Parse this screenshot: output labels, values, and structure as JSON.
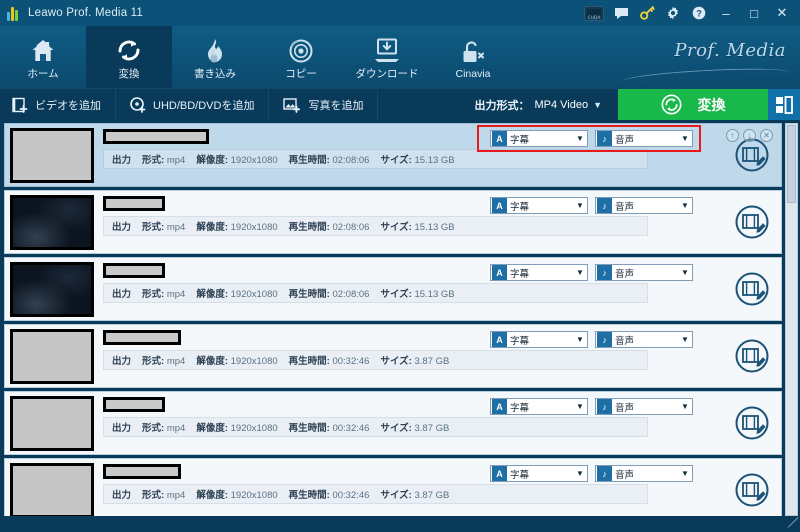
{
  "window": {
    "title": "Leawo Prof. Media 11",
    "logo_icon": "leawo-logo",
    "titlebar_icons": [
      {
        "name": "cuda-badge-icon",
        "label": "CUDA"
      },
      {
        "name": "feedback-icon",
        "label": "■"
      },
      {
        "name": "key-icon",
        "label": "⚷"
      },
      {
        "name": "gear-icon",
        "label": "⚙"
      },
      {
        "name": "help-icon",
        "label": "?"
      }
    ],
    "controls": {
      "minimize": "–",
      "maximize": "□",
      "close": "✕"
    }
  },
  "brand": {
    "text": "Prof. Media"
  },
  "nav": {
    "tabs": [
      {
        "label": "ホーム",
        "icon": "home-icon",
        "active": false
      },
      {
        "label": "変換",
        "icon": "convert-icon",
        "active": true
      },
      {
        "label": "書き込み",
        "icon": "burn-icon",
        "active": false
      },
      {
        "label": "コピー",
        "icon": "copy-disc-icon",
        "active": false
      },
      {
        "label": "ダウンロード",
        "icon": "download-icon",
        "active": false
      },
      {
        "label": "Cinavia",
        "icon": "cinavia-lock-icon",
        "active": false
      }
    ]
  },
  "toolbar": {
    "add_video": "ビデオを追加",
    "add_disc": "UHD/BD/DVDを追加",
    "add_photo": "写真を追加",
    "format_label": "出力形式：",
    "format_value": "MP4 Video",
    "format_caret": "▼",
    "convert_button": "変換",
    "panel_toggle_icon": "layout-panel-icon"
  },
  "list": {
    "labels": {
      "output": "出力",
      "format": "形式:",
      "resolution": "解像度:",
      "duration": "再生時間:",
      "size": "サイズ:"
    },
    "subtitle_label": "字幕",
    "subtitle_icon_glyph": "A",
    "audio_label": "音声",
    "audio_icon_glyph": "♪",
    "dropdown_arrow": "▼",
    "row_tools": {
      "up": "↑",
      "down": "↓",
      "remove": "✕"
    },
    "edit_icon": "edit-video-icon",
    "rows": [
      {
        "format": "mp4",
        "resolution": "1920x1080",
        "duration": "02:08:06",
        "size": "15.13 GB",
        "selected": true,
        "thumb": "light",
        "title_width": 106
      },
      {
        "format": "mp4",
        "resolution": "1920x1080",
        "duration": "02:08:06",
        "size": "15.13 GB",
        "selected": false,
        "thumb": "dark",
        "title_width": 62
      },
      {
        "format": "mp4",
        "resolution": "1920x1080",
        "duration": "02:08:06",
        "size": "15.13 GB",
        "selected": false,
        "thumb": "dark",
        "title_width": 62
      },
      {
        "format": "mp4",
        "resolution": "1920x1080",
        "duration": "00:32:46",
        "size": "3.87 GB",
        "selected": false,
        "thumb": "light",
        "title_width": 78
      },
      {
        "format": "mp4",
        "resolution": "1920x1080",
        "duration": "00:32:46",
        "size": "3.87 GB",
        "selected": false,
        "thumb": "light",
        "title_width": 62
      },
      {
        "format": "mp4",
        "resolution": "1920x1080",
        "duration": "00:32:46",
        "size": "3.87 GB",
        "selected": false,
        "thumb": "light",
        "title_width": 78
      }
    ]
  },
  "colors": {
    "window_bg": "#0a3a59",
    "titlebar": "#0c5278",
    "accent_green": "#18b84a",
    "highlight_red": "#e8191b",
    "row_selected": "#bfd8ea"
  }
}
